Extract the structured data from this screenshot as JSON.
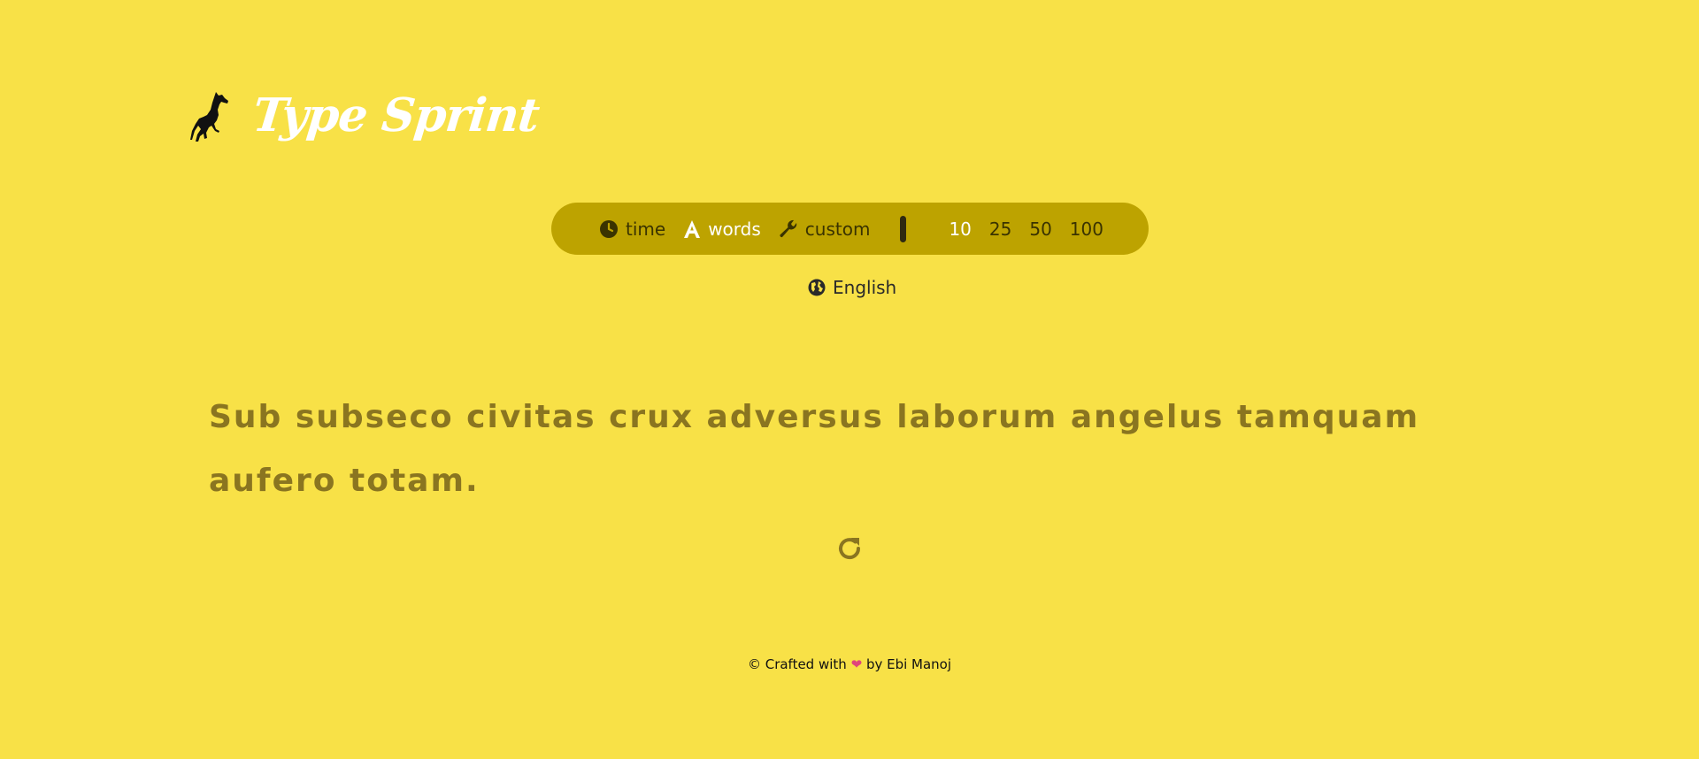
{
  "header": {
    "logo_icon": "horse-icon",
    "title": "Type Sprint"
  },
  "config": {
    "modes": [
      {
        "icon": "clock-icon",
        "label": "time",
        "active": false
      },
      {
        "icon": "letter-a-icon",
        "label": "words",
        "active": true
      },
      {
        "icon": "wrench-icon",
        "label": "custom",
        "active": false
      }
    ],
    "counts": [
      {
        "label": "10",
        "active": true
      },
      {
        "label": "25",
        "active": false
      },
      {
        "label": "50",
        "active": false
      },
      {
        "label": "100",
        "active": false
      }
    ]
  },
  "language": {
    "icon": "globe-icon",
    "label": "English"
  },
  "test": {
    "text": "Sub subseco civitas crux adversus laborum angelus tamquam aufero totam."
  },
  "restart": {
    "icon": "restart-icon"
  },
  "footer": {
    "prefix": "© Crafted with",
    "heart_icon": "heart-icon",
    "suffix": "by Ebi Manoj"
  },
  "colors": {
    "background": "#f8e147",
    "bar": "#bda300",
    "active_text": "#ffffff",
    "words": "#8a7520"
  }
}
